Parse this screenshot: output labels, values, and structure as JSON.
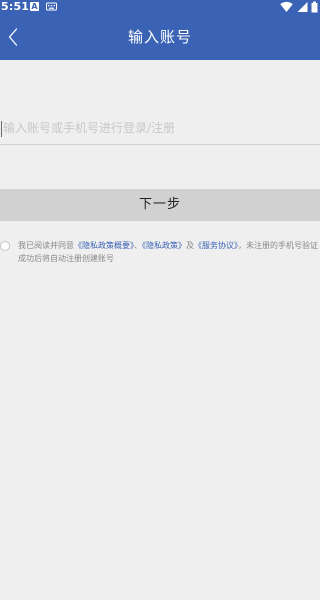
{
  "status_bar": {
    "time": "5:51",
    "notification_a": "A",
    "icons": [
      "notification-a-icon",
      "keyboard-icon",
      "wifi-icon",
      "signal-icon",
      "battery-icon"
    ]
  },
  "header": {
    "title": "输入账号",
    "back_icon": "chevron-left-icon"
  },
  "account": {
    "value": "",
    "placeholder": "输入账号或手机号进行登录/注册"
  },
  "next_button": {
    "label": "下一步"
  },
  "agreement": {
    "checked": false,
    "prefix": "我已阅读并同意",
    "link_privacy_summary": "《隐私政策概要》",
    "separator": "、",
    "link_privacy_policy": "《隐私政策》",
    "and": "及",
    "link_service_agreement": "《服务协议》",
    "suffix": "，未注册的手机号验证成功后将自动注册创建账号"
  },
  "colors": {
    "primary": "#3b63b5",
    "background": "#efefef",
    "button_bg": "#d1d1d1",
    "link": "#3b63b5",
    "muted_text": "#888888"
  }
}
